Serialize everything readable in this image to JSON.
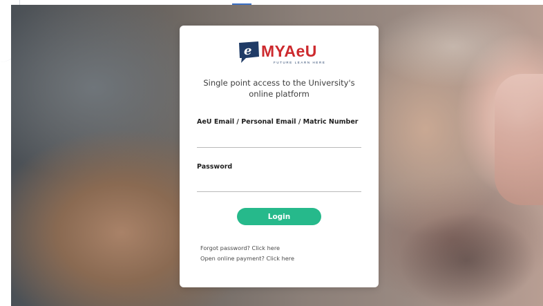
{
  "logo": {
    "icon_letter": "e",
    "brand": "MYAeU",
    "tagline": "FUTURE LEARN HERE",
    "colors": {
      "brand_red": "#cd2a2e",
      "brand_navy": "#1f3b66"
    }
  },
  "intro": {
    "line1": "Single point access to the University's",
    "line2": "online platform"
  },
  "login_form": {
    "identifier_label": "AeU Email / Personal Email / Matric Number",
    "identifier_value": "",
    "password_label": "Password",
    "password_value": "",
    "login_button_label": "Login",
    "button_color": "#26b98b"
  },
  "links": {
    "forgot_password": "Forgot password? Click here",
    "online_payment": "Open online payment? Click here"
  }
}
